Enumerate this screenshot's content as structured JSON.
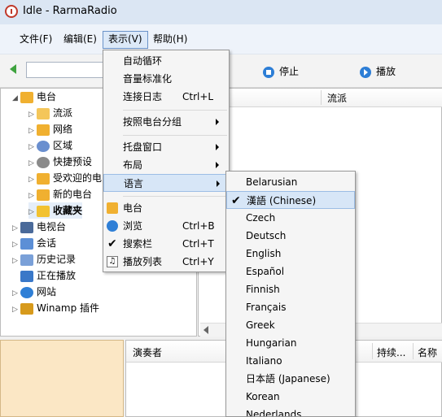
{
  "window": {
    "title": "Idle - RarmaRadio"
  },
  "menubar": [
    {
      "label": "文件(F)"
    },
    {
      "label": "编辑(E)"
    },
    {
      "label": "表示(V)"
    },
    {
      "label": "帮助(H)"
    }
  ],
  "toolbar": {
    "stop_label": "停止",
    "play_label": "播放"
  },
  "tree": [
    {
      "label": "电台",
      "icon": "radio-icon",
      "color": "#f0b030"
    },
    {
      "label": "流派",
      "icon": "folder-icon",
      "color": "#f4c65a"
    },
    {
      "label": "网络",
      "icon": "radio-icon",
      "color": "#f0b030"
    },
    {
      "label": "区域",
      "icon": "globe-icon",
      "color": "#6a8fcf"
    },
    {
      "label": "快捷预设",
      "icon": "preset-icon",
      "color": "#8a8a8a"
    },
    {
      "label": "受欢迎的电",
      "icon": "radio-icon",
      "color": "#f0b030"
    },
    {
      "label": "新的电台",
      "icon": "radio-icon",
      "color": "#f0b030"
    },
    {
      "label": "收藏夹",
      "icon": "star-icon",
      "color": "#f2c230"
    },
    {
      "label": "电视台",
      "icon": "tv-icon",
      "color": "#4a6a9a"
    },
    {
      "label": "会话",
      "icon": "users-icon",
      "color": "#5c8fd6"
    },
    {
      "label": "历史记录",
      "icon": "history-icon",
      "color": "#7aa0d8"
    },
    {
      "label": "正在播放",
      "icon": "list-icon",
      "color": "#3a78c8"
    },
    {
      "label": "网站",
      "icon": "ie-icon",
      "color": "#2f7fd6"
    },
    {
      "label": "Winamp 插件",
      "icon": "winamp-icon",
      "color": "#d79a1c"
    }
  ],
  "list_header": {
    "genre": "流派"
  },
  "tracks_header": {
    "performer": "演奏者",
    "duration": "持续...",
    "name": "名称"
  },
  "view_menu": {
    "items": [
      {
        "label": "自动循环",
        "shortcut": ""
      },
      {
        "label": "音量标准化",
        "shortcut": ""
      },
      {
        "label": "连接日志",
        "shortcut": "Ctrl+L"
      },
      {
        "label": "按照电台分组",
        "shortcut": ""
      },
      {
        "label": "托盘窗口",
        "shortcut": ""
      },
      {
        "label": "布局",
        "shortcut": ""
      },
      {
        "label": "语言",
        "shortcut": ""
      },
      {
        "label": "电台",
        "shortcut": ""
      },
      {
        "label": "浏览",
        "shortcut": "Ctrl+B"
      },
      {
        "label": "搜索栏",
        "shortcut": "Ctrl+T"
      },
      {
        "label": "播放列表",
        "shortcut": "Ctrl+Y"
      }
    ]
  },
  "language_menu": {
    "items": [
      {
        "label": "Belarusian"
      },
      {
        "label": "漢語 (Chinese)"
      },
      {
        "label": "Czech"
      },
      {
        "label": "Deutsch"
      },
      {
        "label": "English"
      },
      {
        "label": "Español"
      },
      {
        "label": "Finnish"
      },
      {
        "label": "Français"
      },
      {
        "label": "Greek"
      },
      {
        "label": "Hungarian"
      },
      {
        "label": "Italiano"
      },
      {
        "label": "日本語 (Japanese)"
      },
      {
        "label": "Korean"
      },
      {
        "label": "Nederlands"
      }
    ]
  },
  "colors": {
    "accent": "#2d7ed6",
    "menu_highlight": "#d7e6f7",
    "album_bg": "#fbe7c5"
  }
}
